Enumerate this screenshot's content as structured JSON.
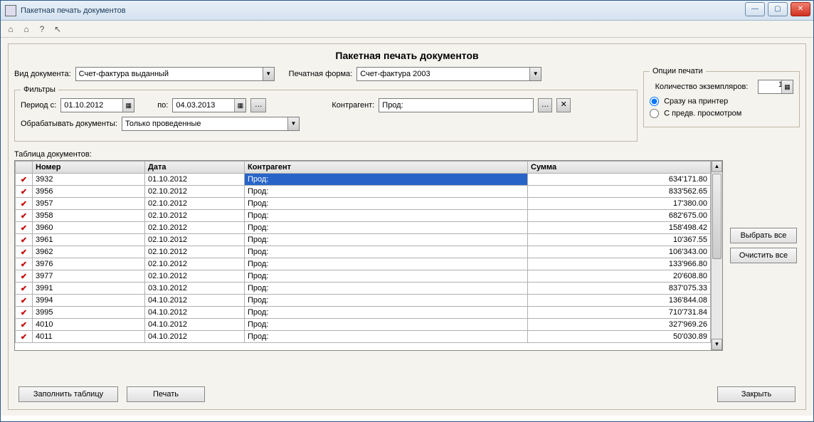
{
  "window": {
    "title": "Пакетная печать документов"
  },
  "heading": "Пакетная печать документов",
  "labels": {
    "doc_type": "Вид документа:",
    "print_form": "Печатная форма:",
    "filters": "Фильтры",
    "period_from": "Период с:",
    "period_to": "по:",
    "counterparty": "Контрагент:",
    "process_docs": "Обрабатывать документы:",
    "print_opts": "Опции печати",
    "copies": "Количество экземпляров:",
    "to_printer": "Сразу на принтер",
    "with_preview": "С предв. просмотром",
    "table": "Таблица документов:"
  },
  "values": {
    "doc_type": "Счет-фактура выданный",
    "print_form": "Счет-фактура 2003",
    "date_from": "01.10.2012",
    "date_to": "04.03.2013",
    "counterparty": "Прод:",
    "process_mode": "Только проведенные",
    "copies": "1"
  },
  "columns": {
    "chk": "",
    "number": "Номер",
    "date": "Дата",
    "counterparty": "Контрагент",
    "sum": "Сумма"
  },
  "rows": [
    {
      "n": "3932",
      "d": "01.10.2012",
      "k": "Прод:",
      "s": "634'171.80",
      "sel": true
    },
    {
      "n": "3956",
      "d": "02.10.2012",
      "k": "Прод:",
      "s": "833'562.65"
    },
    {
      "n": "3957",
      "d": "02.10.2012",
      "k": "Прод:",
      "s": "17'380.00"
    },
    {
      "n": "3958",
      "d": "02.10.2012",
      "k": "Прод:",
      "s": "682'675.00"
    },
    {
      "n": "3960",
      "d": "02.10.2012",
      "k": "Прод:",
      "s": "158'498.42"
    },
    {
      "n": "3961",
      "d": "02.10.2012",
      "k": "Прод:",
      "s": "10'367.55"
    },
    {
      "n": "3962",
      "d": "02.10.2012",
      "k": "Прод:",
      "s": "106'343.00"
    },
    {
      "n": "3976",
      "d": "02.10.2012",
      "k": "Прод:",
      "s": "133'966.80"
    },
    {
      "n": "3977",
      "d": "02.10.2012",
      "k": "Прод:",
      "s": "20'608.80"
    },
    {
      "n": "3991",
      "d": "03.10.2012",
      "k": "Прод:",
      "s": "837'075.33"
    },
    {
      "n": "3994",
      "d": "04.10.2012",
      "k": "Прод:",
      "s": "136'844.08"
    },
    {
      "n": "3995",
      "d": "04.10.2012",
      "k": "Прод:",
      "s": "710'731.84"
    },
    {
      "n": "4010",
      "d": "04.10.2012",
      "k": "Прод:",
      "s": "327'969.26"
    },
    {
      "n": "4011",
      "d": "04.10.2012",
      "k": "Прод:",
      "s": "50'030.89"
    }
  ],
  "buttons": {
    "select_all": "Выбрать все",
    "clear_all": "Очистить все",
    "fill_table": "Заполнить таблицу",
    "print": "Печать",
    "close": "Закрыть"
  }
}
